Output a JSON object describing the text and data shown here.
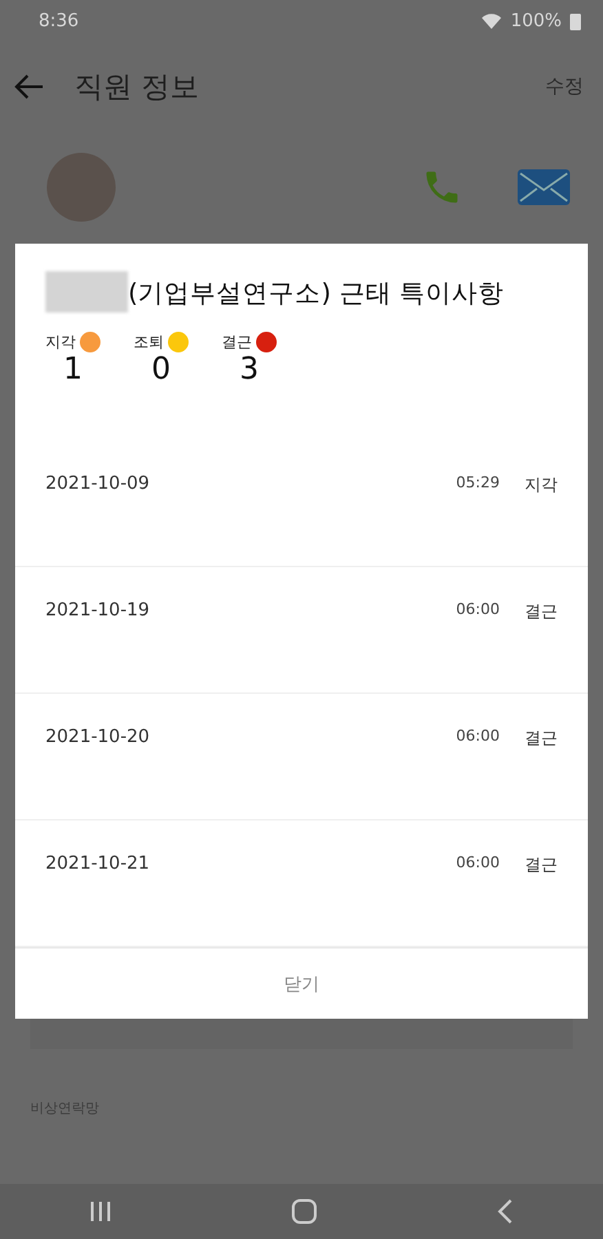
{
  "status_bar": {
    "time": "8:36",
    "battery": "100%"
  },
  "app_bar": {
    "title": "직원 정보",
    "action": "수정"
  },
  "background": {
    "section_label": "비상연락망"
  },
  "dialog": {
    "title": "(기업부설연구소) 근태 특이사항",
    "legend": [
      {
        "label": "지각",
        "count": "1",
        "color": "#f79a3e"
      },
      {
        "label": "조퇴",
        "count": "0",
        "color": "#fbc70c"
      },
      {
        "label": "결근",
        "count": "3",
        "color": "#d7200f"
      }
    ],
    "records": [
      {
        "date": "2021-10-09",
        "time": "05:29",
        "type": "지각"
      },
      {
        "date": "2021-10-19",
        "time": "06:00",
        "type": "결근"
      },
      {
        "date": "2021-10-20",
        "time": "06:00",
        "type": "결근"
      },
      {
        "date": "2021-10-21",
        "time": "06:00",
        "type": "결근"
      }
    ],
    "close_button": "닫기"
  }
}
